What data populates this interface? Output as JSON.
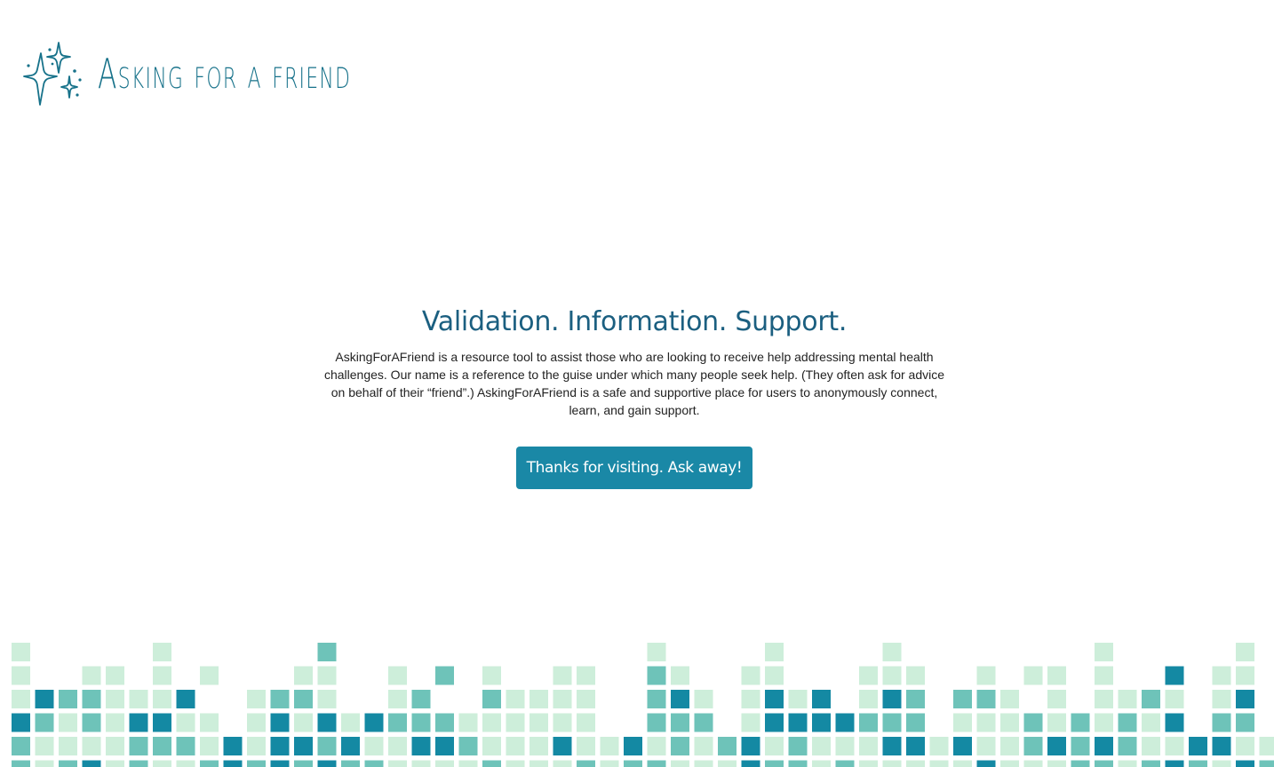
{
  "brand": {
    "name": "Asking for a friend",
    "color": "#17728a"
  },
  "hero": {
    "title": "Validation. Information. Support.",
    "body": "AskingForAFriend is a resource tool to assist those who are looking to receive help addressing mental health challenges. Our name is a reference to the guise under which many people seek help. (They often ask for advice on behalf of their “friend”.) AskingForAFriend is a safe and supportive place for users to anonymously connect, learn, and gain support.",
    "cta_label": "Thanks for visiting. Ask away!"
  },
  "colors": {
    "title": "#1b5f80",
    "button": "#1a88a6",
    "tile_light": "#cdeeda",
    "tile_medium": "#6ec3b9",
    "tile_dark": "#1489a3"
  },
  "icons": {
    "logo": "sparkles-icon"
  }
}
